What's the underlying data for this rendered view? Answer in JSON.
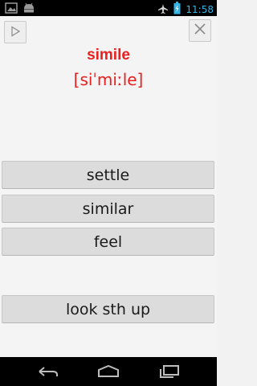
{
  "status_bar": {
    "time": "11:58",
    "icons": [
      "image-icon",
      "android-icon",
      "airplane-icon",
      "battery-charging-icon"
    ]
  },
  "card": {
    "word": "simile",
    "phonetic": "[siˈmiːle]"
  },
  "options": [
    {
      "label": "settle"
    },
    {
      "label": "similar"
    },
    {
      "label": "feel"
    }
  ],
  "extra_action": {
    "label": "look sth up"
  },
  "nav_bar": {
    "icons": [
      "back-icon",
      "home-icon",
      "recent-apps-icon"
    ]
  },
  "colors": {
    "accent": "#e8201f",
    "status_blue": "#33b5e5",
    "button_bg": "#dcdcdc"
  }
}
